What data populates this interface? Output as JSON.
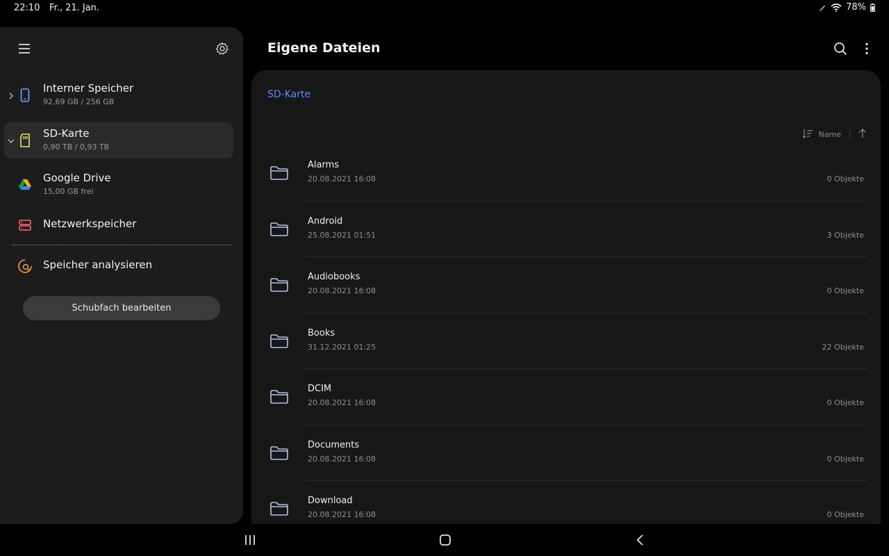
{
  "status_bar": {
    "time": "22:10",
    "date": "Fr., 21. Jan.",
    "battery": "78%"
  },
  "sidebar": {
    "items": [
      {
        "title": "Interner Speicher",
        "subtitle": "92,69 GB / 256 GB",
        "icon": "phone-icon",
        "chevron": "chevron-right-icon"
      },
      {
        "title": "SD-Karte",
        "subtitle": "0,90 TB / 0,93 TB",
        "icon": "sd-card-icon",
        "chevron": "chevron-down-icon",
        "selected": true
      },
      {
        "title": "Google Drive",
        "subtitle": "15,00 GB frei",
        "icon": "google-drive-icon"
      },
      {
        "title": "Netzwerkspeicher",
        "subtitle": "",
        "icon": "network-storage-icon"
      }
    ],
    "analyze_label": "Speicher analysieren",
    "edit_drawer_label": "Schubfach bearbeiten"
  },
  "header": {
    "title": "Eigene Dateien"
  },
  "main": {
    "breadcrumb": "SD-Karte",
    "sort_label": "Name",
    "files": [
      {
        "name": "Alarms",
        "date": "20.08.2021 16:08",
        "count": "0 Objekte"
      },
      {
        "name": "Android",
        "date": "25.08.2021 01:51",
        "count": "3 Objekte"
      },
      {
        "name": "Audiobooks",
        "date": "20.08.2021 16:08",
        "count": "0 Objekte"
      },
      {
        "name": "Books",
        "date": "31.12.2021 01:25",
        "count": "22 Objekte"
      },
      {
        "name": "DCIM",
        "date": "20.08.2021 16:08",
        "count": "0 Objekte"
      },
      {
        "name": "Documents",
        "date": "20.08.2021 16:08",
        "count": "0 Objekte"
      },
      {
        "name": "Download",
        "date": "20.08.2021 16:08",
        "count": "0 Objekte"
      }
    ]
  },
  "colors": {
    "accent": "#5b8df5",
    "phone_icon": "#6fa8ff",
    "sd_icon": "#e8e07a",
    "network_icon": "#f06a7a",
    "analyze_icon": "#f0a040"
  }
}
